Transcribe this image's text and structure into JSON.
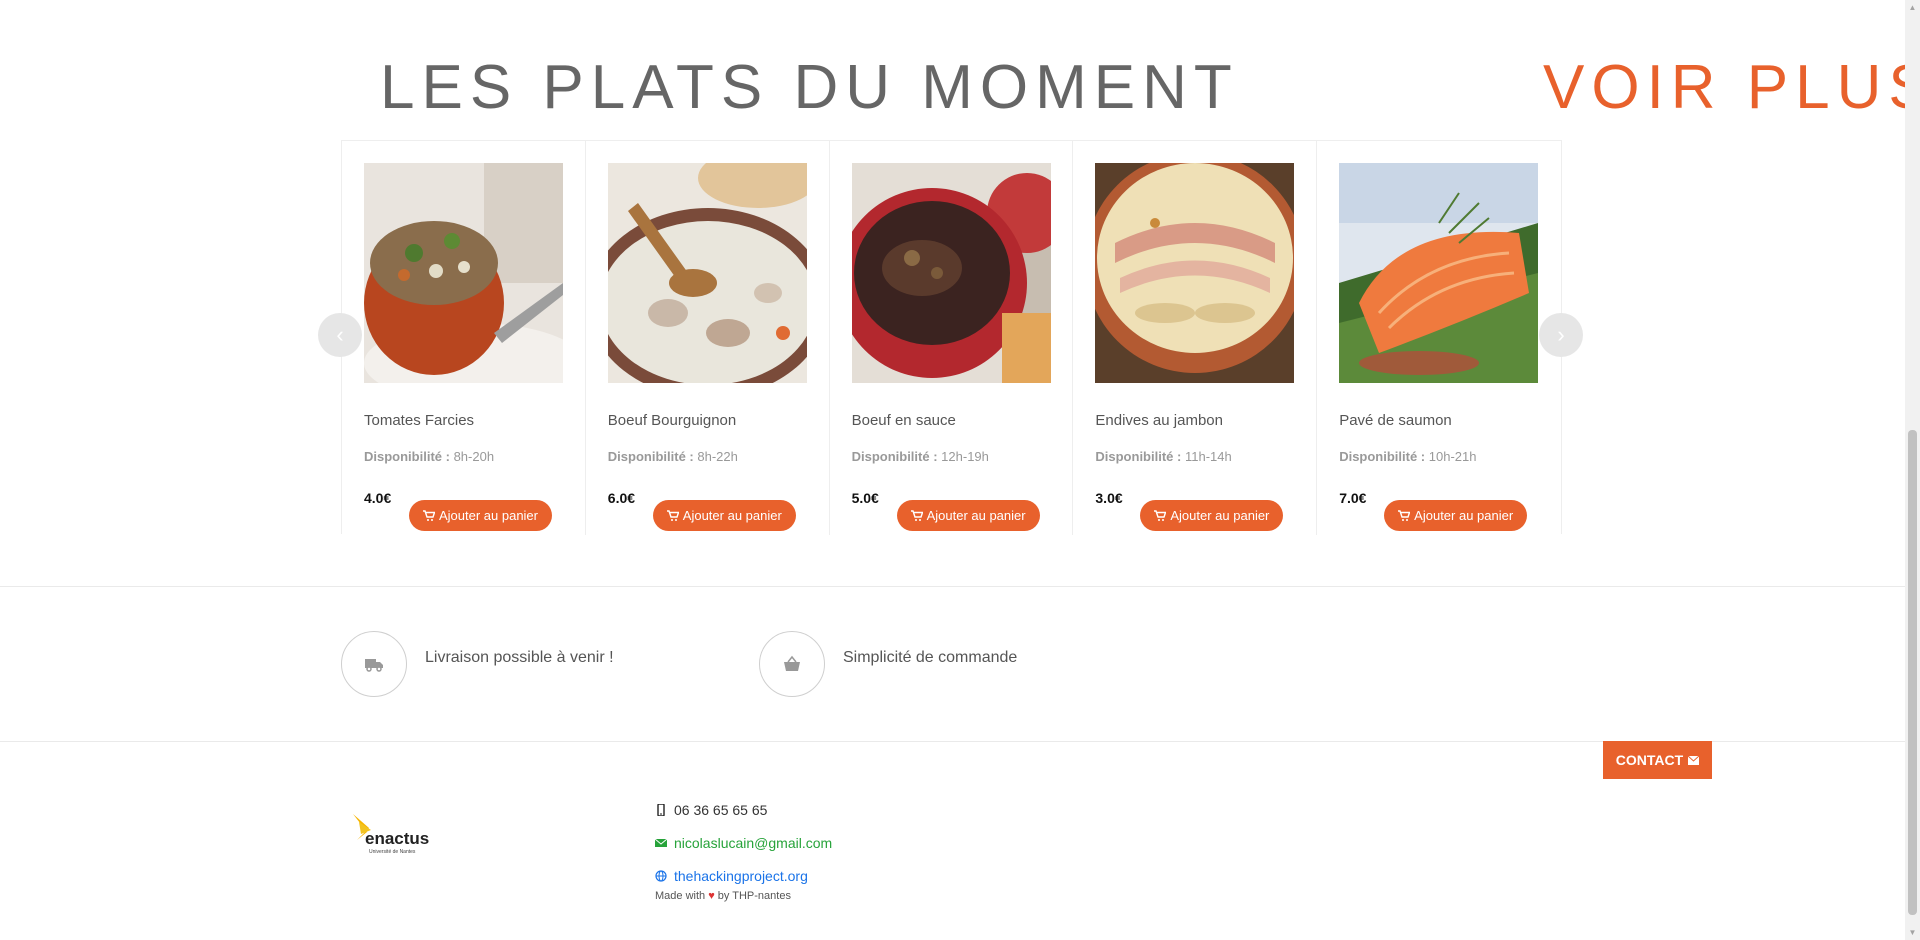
{
  "header": {
    "title": "LES PLATS DU MOMENT",
    "see_more": "VOIR PLUS"
  },
  "colors": {
    "accent": "#e8612c",
    "email_green": "#27a33a",
    "link_blue": "#1a73e8"
  },
  "carousel": {
    "prev_icon": "chevron-left-icon",
    "next_icon": "chevron-right-icon",
    "dispo_label": "Disponibilité :",
    "cart_label": "Ajouter au panier",
    "cart_icon": "cart-icon",
    "dishes": [
      {
        "name": "Tomates Farcies",
        "hours": "8h-20h",
        "price": "4.0€",
        "image": "stuffed-tomato-image"
      },
      {
        "name": "Boeuf Bourguignon",
        "hours": "8h-22h",
        "price": "6.0€",
        "image": "creamy-stew-image"
      },
      {
        "name": "Boeuf en sauce",
        "hours": "12h-19h",
        "price": "5.0€",
        "image": "beef-casserole-image"
      },
      {
        "name": "Endives au jambon",
        "hours": "11h-14h",
        "price": "3.0€",
        "image": "endive-gratin-image"
      },
      {
        "name": "Pavé de saumon",
        "hours": "10h-21h",
        "price": "7.0€",
        "image": "salmon-fillet-image"
      }
    ]
  },
  "features": [
    {
      "text": "Livraison possible à venir !",
      "icon": "truck-icon"
    },
    {
      "text": "Simplicité de commande",
      "icon": "basket-icon"
    }
  ],
  "contact_button": {
    "label": "CONTACT",
    "icon": "envelope-icon"
  },
  "footer": {
    "logo_text": "enactus",
    "logo_sub": "Université de Nantes",
    "phone": "06 36 65 65 65",
    "email": "nicolaslucain@gmail.com",
    "website": "thehackingproject.org",
    "made_with_prefix": "Made with",
    "made_with_suffix": "by THP-nantes"
  }
}
